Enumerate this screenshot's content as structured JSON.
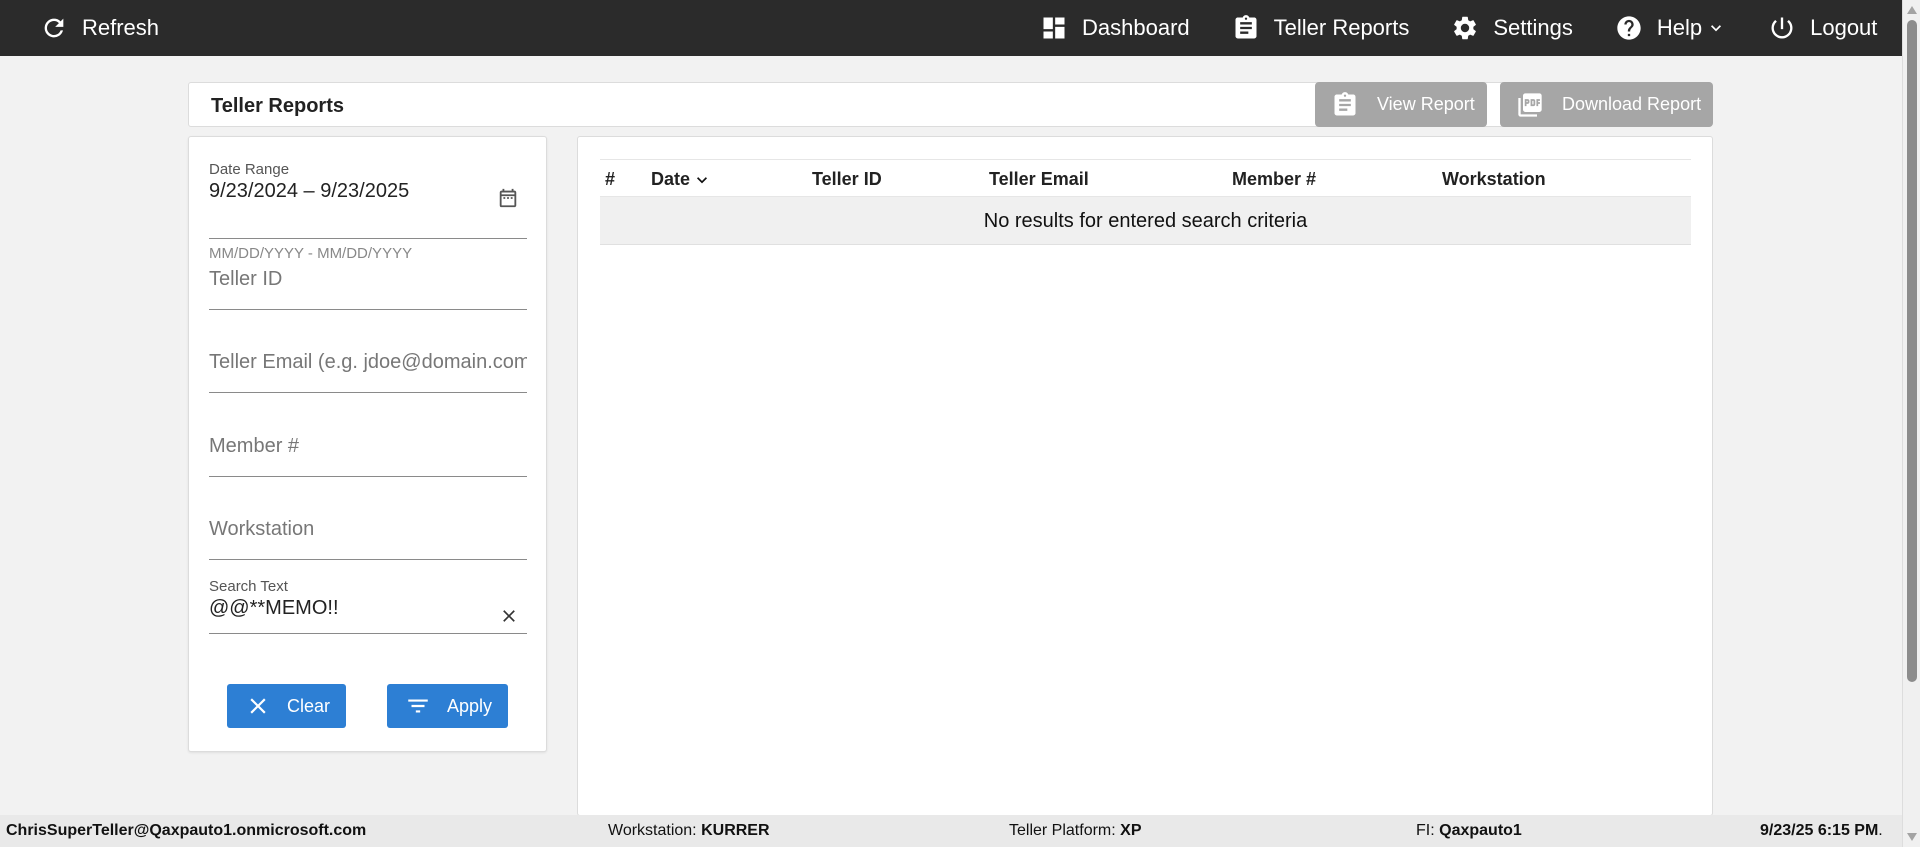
{
  "topbar": {
    "refresh_label": "Refresh",
    "nav": [
      {
        "label": "Dashboard",
        "icon": "dashboard-icon"
      },
      {
        "label": "Teller Reports",
        "icon": "clipboard-icon"
      },
      {
        "label": "Settings",
        "icon": "gear-icon"
      },
      {
        "label": "Help",
        "icon": "help-icon"
      },
      {
        "label": "Logout",
        "icon": "power-icon"
      }
    ]
  },
  "header": {
    "title": "Teller Reports",
    "view_report_label": "View Report",
    "download_report_label": "Download Report"
  },
  "filters": {
    "date_range": {
      "label": "Date Range",
      "value": "9/23/2024 – 9/23/2025",
      "hint": "MM/DD/YYYY - MM/DD/YYYY"
    },
    "teller_id": {
      "placeholder": "Teller ID"
    },
    "teller_email": {
      "placeholder": "Teller Email (e.g. jdoe@domain.com"
    },
    "member": {
      "placeholder": "Member #"
    },
    "workstation": {
      "placeholder": "Workstation"
    },
    "search_text": {
      "label": "Search Text",
      "value": "@@**MEMO!!"
    },
    "clear_label": "Clear",
    "apply_label": "Apply"
  },
  "results": {
    "columns": [
      "#",
      "Date",
      "Teller ID",
      "Teller Email",
      "Member #",
      "Workstation"
    ],
    "empty_message": "No results for entered search criteria"
  },
  "status": {
    "user": "ChrisSuperTeller@Qaxpauto1.onmicrosoft.com",
    "workstation_label": "Workstation:",
    "workstation_value": "KURRER",
    "platform_label": "Teller Platform:",
    "platform_value": "XP",
    "fi_label": "FI:",
    "fi_value": "Qaxpauto1",
    "datetime": "9/23/25 6:15 PM",
    "datetime_suffix": "."
  },
  "colors": {
    "topbar": "#2b2b2b",
    "primary_button": "#2d7fd4",
    "disabled_button": "#a6a6a6"
  }
}
